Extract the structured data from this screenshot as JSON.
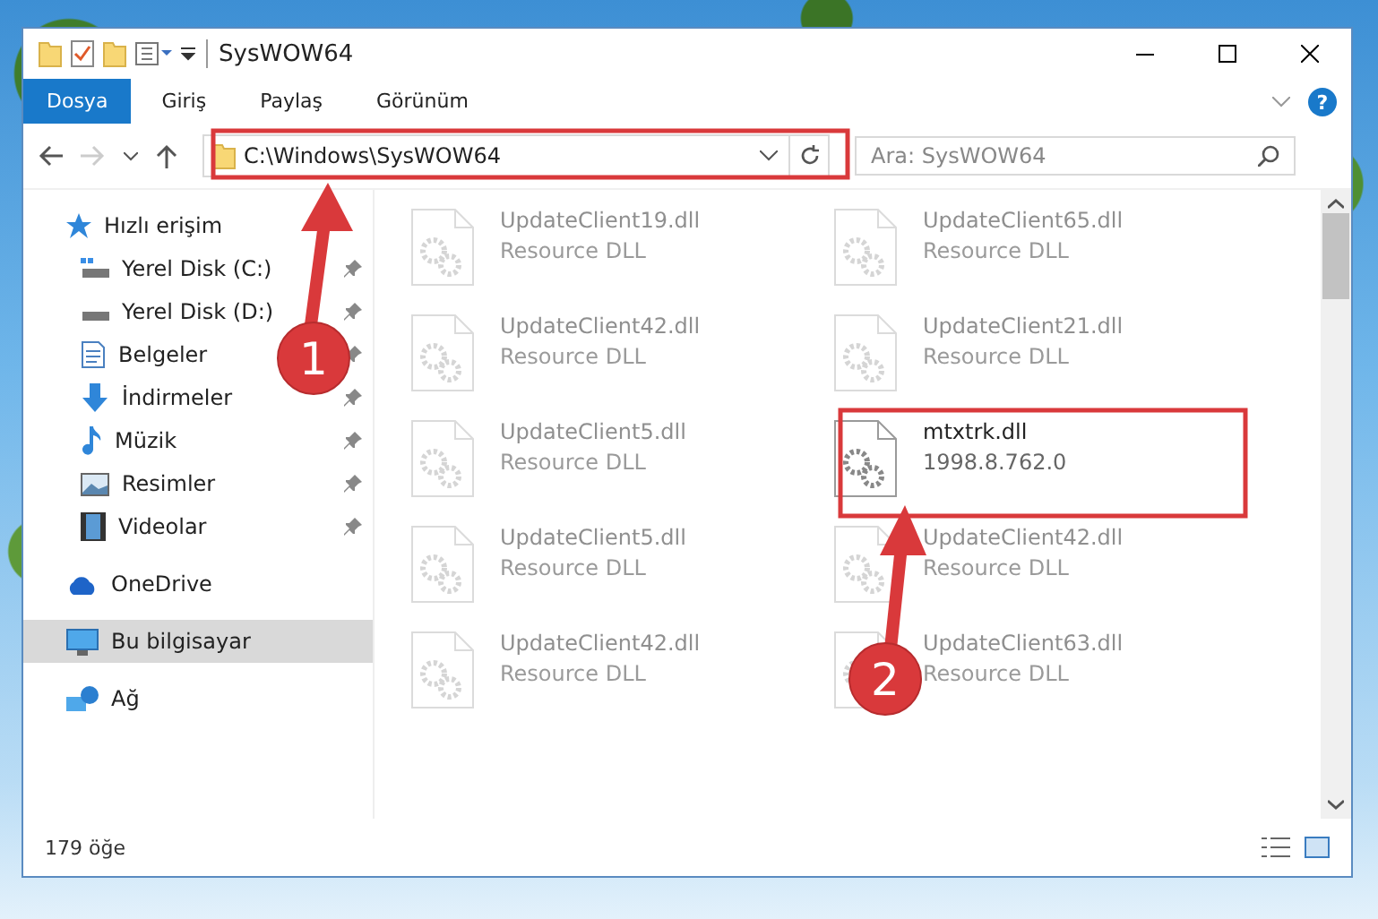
{
  "window": {
    "title": "SysWOW64"
  },
  "ribbon_tabs": [
    {
      "label": "Dosya",
      "selected": true
    },
    {
      "label": "Giriş",
      "selected": false
    },
    {
      "label": "Paylaş",
      "selected": false
    },
    {
      "label": "Görünüm",
      "selected": false
    }
  ],
  "help_label": "?",
  "address": {
    "value": "C:\\Windows\\SysWOW64"
  },
  "search": {
    "placeholder": "Ara: SysWOW64"
  },
  "sidebar": {
    "items": [
      {
        "label": "Hızlı erişim",
        "selected": false,
        "children": [
          {
            "label": "Yerel Disk (C:)",
            "pinned": true
          },
          {
            "label": "Yerel Disk (D:)",
            "pinned": true
          },
          {
            "label": "Belgeler",
            "pinned": true
          },
          {
            "label": "İndirmeler",
            "pinned": true
          },
          {
            "label": "Müzik",
            "pinned": true
          },
          {
            "label": "Resimler",
            "pinned": true
          },
          {
            "label": "Videolar",
            "pinned": true
          }
        ]
      },
      {
        "label": "OneDrive",
        "selected": false
      },
      {
        "label": "Bu bilgisayar",
        "selected": true
      },
      {
        "label": "Ağ",
        "selected": false
      }
    ]
  },
  "files": [
    {
      "name": "UpdateClient19.dll",
      "detail": "Resource DLL",
      "blurred": true
    },
    {
      "name": "UpdateClient65.dll",
      "detail": "Resource DLL",
      "blurred": true
    },
    {
      "name": "UpdateClient42.dll",
      "detail": "Resource DLL",
      "blurred": true
    },
    {
      "name": "UpdateClient21.dll",
      "detail": "Resource DLL",
      "blurred": true
    },
    {
      "name": "UpdateClient5.dll",
      "detail": "Resource DLL",
      "blurred": true
    },
    {
      "name": "mtxtrk.dll",
      "detail": "1998.8.762.0",
      "blurred": false
    },
    {
      "name": "UpdateClient5.dll",
      "detail": "Resource DLL",
      "blurred": true
    },
    {
      "name": "UpdateClient42.dll",
      "detail": "Resource DLL",
      "blurred": true
    },
    {
      "name": "UpdateClient42.dll",
      "detail": "Resource DLL",
      "blurred": true
    },
    {
      "name": "UpdateClient63.dll",
      "detail": "Resource DLL",
      "blurred": true
    }
  ],
  "status_bar": {
    "count": "179 öğe"
  },
  "annotations": [
    {
      "number": "1"
    },
    {
      "number": "2"
    }
  ]
}
